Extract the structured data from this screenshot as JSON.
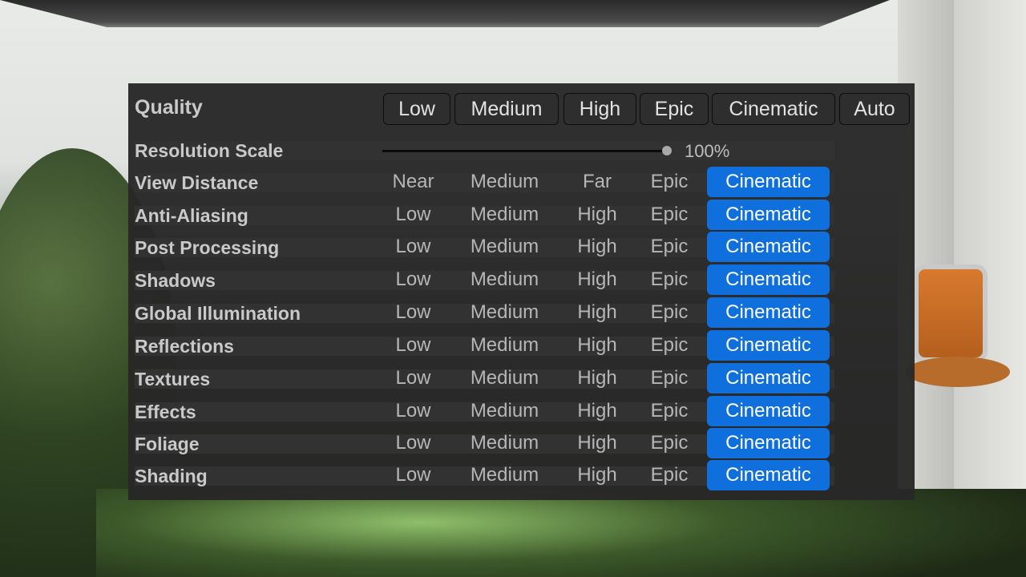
{
  "quality": {
    "title": "Quality",
    "presets": [
      "Low",
      "Medium",
      "High",
      "Epic",
      "Cinematic",
      "Auto"
    ]
  },
  "resolution_scale": {
    "label": "Resolution Scale",
    "value_text": "100%",
    "value": 1.0
  },
  "settings": [
    {
      "label": "View Distance",
      "options": [
        "Near",
        "Medium",
        "Far",
        "Epic",
        "Cinematic"
      ],
      "selected": "Cinematic"
    },
    {
      "label": "Anti-Aliasing",
      "options": [
        "Low",
        "Medium",
        "High",
        "Epic",
        "Cinematic"
      ],
      "selected": "Cinematic"
    },
    {
      "label": "Post Processing",
      "options": [
        "Low",
        "Medium",
        "High",
        "Epic",
        "Cinematic"
      ],
      "selected": "Cinematic"
    },
    {
      "label": "Shadows",
      "options": [
        "Low",
        "Medium",
        "High",
        "Epic",
        "Cinematic"
      ],
      "selected": "Cinematic"
    },
    {
      "label": "Global Illumination",
      "options": [
        "Low",
        "Medium",
        "High",
        "Epic",
        "Cinematic"
      ],
      "selected": "Cinematic"
    },
    {
      "label": "Reflections",
      "options": [
        "Low",
        "Medium",
        "High",
        "Epic",
        "Cinematic"
      ],
      "selected": "Cinematic"
    },
    {
      "label": "Textures",
      "options": [
        "Low",
        "Medium",
        "High",
        "Epic",
        "Cinematic"
      ],
      "selected": "Cinematic"
    },
    {
      "label": "Effects",
      "options": [
        "Low",
        "Medium",
        "High",
        "Epic",
        "Cinematic"
      ],
      "selected": "Cinematic"
    },
    {
      "label": "Foliage",
      "options": [
        "Low",
        "Medium",
        "High",
        "Epic",
        "Cinematic"
      ],
      "selected": "Cinematic"
    },
    {
      "label": "Shading",
      "options": [
        "Low",
        "Medium",
        "High",
        "Epic",
        "Cinematic"
      ],
      "selected": "Cinematic"
    }
  ],
  "colors": {
    "panel_bg": "#282828",
    "selected_accent": "#0f6fdc",
    "label_text": "#c9c9c9",
    "option_text": "#b6b6b6"
  }
}
